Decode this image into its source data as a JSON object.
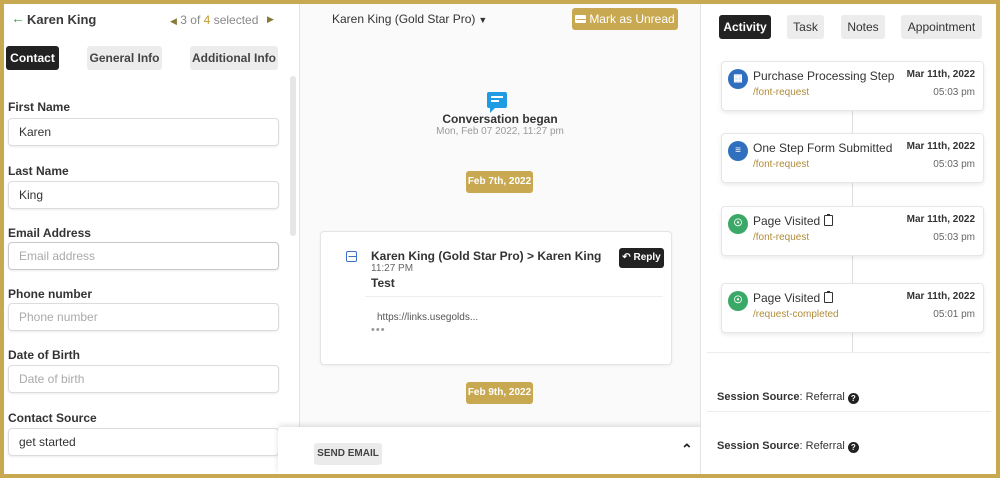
{
  "left": {
    "back_icon": "arrow-left-icon",
    "contact_name": "Karen King",
    "pager": {
      "current": "3",
      "of": "of",
      "total": "4",
      "label": "selected"
    },
    "tabs": [
      {
        "label": "Contact",
        "active": true
      },
      {
        "label": "General Info",
        "active": false
      },
      {
        "label": "Additional Info",
        "active": false
      }
    ],
    "fields": {
      "first_name": {
        "label": "First Name",
        "value": "Karen",
        "placeholder": ""
      },
      "last_name": {
        "label": "Last Name",
        "value": "King",
        "placeholder": ""
      },
      "email": {
        "label": "Email Address",
        "value": "",
        "placeholder": "Email address"
      },
      "phone": {
        "label": "Phone number",
        "value": "",
        "placeholder": "Phone number"
      },
      "dob": {
        "label": "Date of Birth",
        "value": "",
        "placeholder": "Date of birth"
      },
      "source": {
        "label": "Contact Source",
        "value": "get started",
        "placeholder": ""
      }
    }
  },
  "center": {
    "contact_title": "Karen King (Gold Star Pro)",
    "mark_unread": "Mark as Unread",
    "conversation": {
      "title": "Conversation began",
      "date": "Mon, Feb 07 2022, 11:27 pm"
    },
    "date_pills": [
      "Feb 7th, 2022",
      "Feb 9th, 2022"
    ],
    "message": {
      "from": "Karen King (Gold Star Pro) > Karen King",
      "time": "11:27 PM",
      "subject": "Test",
      "link": "https://links.usegolds...",
      "more": "•••",
      "reply": "Reply"
    },
    "compose": {
      "send": "SEND EMAIL"
    }
  },
  "right": {
    "tabs": [
      {
        "label": "Activity",
        "active": true
      },
      {
        "label": "Task",
        "active": false
      },
      {
        "label": "Notes",
        "active": false
      },
      {
        "label": "Appointment",
        "active": false
      }
    ],
    "activities": [
      {
        "title": "Purchase Processing Step",
        "sub": "/font-request",
        "date": "Mar 11th, 2022",
        "time": "05:03 pm",
        "icon": "briefcase-icon",
        "color": "#2f6fbd",
        "clipboard": false
      },
      {
        "title": "One Step Form Submitted",
        "sub": "/font-request",
        "date": "Mar 11th, 2022",
        "time": "05:03 pm",
        "icon": "form-icon",
        "color": "#2f6fbd",
        "clipboard": false
      },
      {
        "title": "Page Visited",
        "sub": "/font-request",
        "date": "Mar 11th, 2022",
        "time": "05:03 pm",
        "icon": "globe-icon",
        "color": "#3aa866",
        "clipboard": true
      },
      {
        "title": "Page Visited",
        "sub": "/request-completed",
        "date": "Mar 11th, 2022",
        "time": "05:01 pm",
        "icon": "globe-icon",
        "color": "#3aa866",
        "clipboard": true
      }
    ],
    "sessions": [
      {
        "label": "Session Source",
        "value": "Referral"
      },
      {
        "label": "Session Source",
        "value": "Referral"
      }
    ]
  },
  "colors": {
    "accent": "#c8a951",
    "dark": "#222222",
    "link_gold": "#b08c3a",
    "green": "#3aa05a"
  }
}
